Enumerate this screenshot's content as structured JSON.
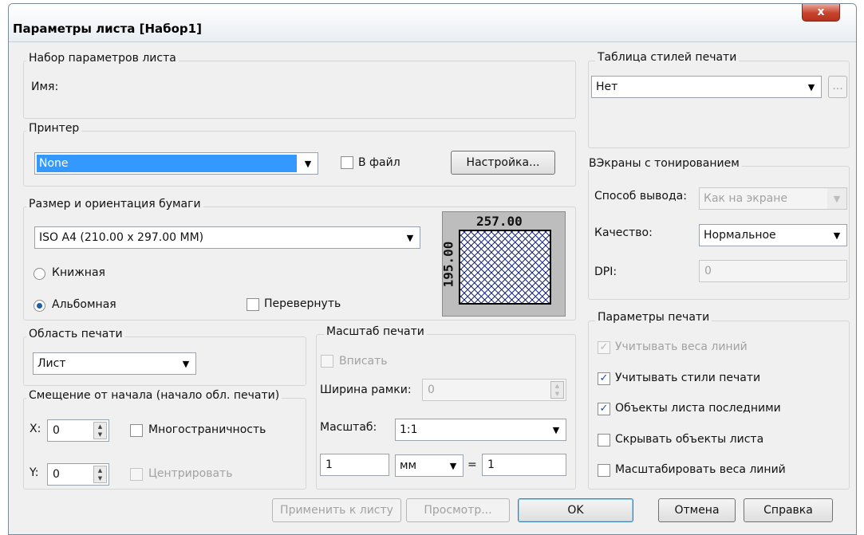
{
  "window": {
    "title": "Параметры листа [Набор1]",
    "close_glyph": "x"
  },
  "sheet_set": {
    "legend": "Набор параметров листа",
    "name_label": "Имя:"
  },
  "printer": {
    "legend": "Принтер",
    "device": "None",
    "to_file_label": "В файл",
    "to_file_checked": false,
    "setup_label": "Настройка..."
  },
  "paper": {
    "legend": "Размер и ориентация бумаги",
    "size": "ISO A4 (210.00 x 297.00 MM)",
    "portrait_label": "Книжная",
    "landscape_label": "Альбомная",
    "orientation": "landscape",
    "flip_label": "Перевернуть",
    "flip_checked": false,
    "preview_width": "257.00",
    "preview_height": "195.00"
  },
  "plot_area": {
    "legend": "Область печати",
    "value": "Лист"
  },
  "offset": {
    "legend": "Смещение от начала (начало обл. печати)",
    "x_label": "X:",
    "x_value": "0",
    "y_label": "Y:",
    "y_value": "0",
    "multipage_label": "Многостраничность",
    "multipage_checked": false,
    "center_label": "Центрировать",
    "center_checked": false
  },
  "scale": {
    "legend": "Масштаб печати",
    "fit_label": "Вписать",
    "fit_checked": false,
    "frame_width_label": "Ширина рамки:",
    "frame_width_value": "0",
    "scale_label": "Масштаб:",
    "scale_value": "1:1",
    "units_value_1": "1",
    "units": "мм",
    "equals": "=",
    "units_value_2": "1"
  },
  "style_table": {
    "legend": "Таблица стилей печати",
    "value": "Нет",
    "browse_label": "..."
  },
  "shaded": {
    "legend": "ВЭкраны с тонированием",
    "output_label": "Способ вывода:",
    "output_value": "Как на экране",
    "quality_label": "Качество:",
    "quality_value": "Нормальное",
    "dpi_label": "DPI:",
    "dpi_value": "0"
  },
  "print_options": {
    "legend": "Параметры печати",
    "items": [
      {
        "label": "Учитывать веса линий",
        "checked": true,
        "enabled": false
      },
      {
        "label": "Учитывать стили печати",
        "checked": true,
        "enabled": true
      },
      {
        "label": "Объекты листа последними",
        "checked": true,
        "enabled": true
      },
      {
        "label": "Скрывать объекты листа",
        "checked": false,
        "enabled": true
      },
      {
        "label": "Масштабировать веса линий",
        "checked": false,
        "enabled": true
      }
    ]
  },
  "buttons": {
    "apply_label": "Применить к листу",
    "preview_label": "Просмотр...",
    "ok_label": "OK",
    "cancel_label": "Отмена",
    "help_label": "Справка"
  },
  "glyphs": {
    "check_mark": "✓",
    "dropdown_arrow": "▼",
    "spin_up": "▲",
    "spin_down": "▼"
  },
  "colors": {
    "selection": "#3399ff",
    "close_button": "#c7432d",
    "disabled_text": "#a2a2a2"
  }
}
